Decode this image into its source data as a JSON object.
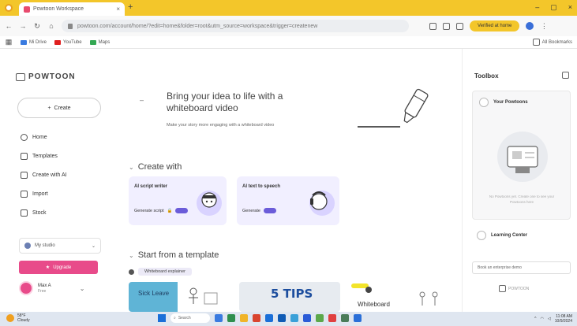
{
  "browser": {
    "tab_title": "Powtoon Workspace",
    "tab_close": "×",
    "new_tab": "+",
    "window_controls": [
      "–",
      "▢",
      "×"
    ],
    "url": "powtoon.com/account/home/?edit=home&folder=root&utm_source=workspace&trigger=createnew",
    "verify_label": "Verified at home",
    "bookmarks": [
      {
        "label": "Mi Drive",
        "color": "#3a7be0"
      },
      {
        "label": "YouTube",
        "color": "#e02020"
      },
      {
        "label": "Maps",
        "color": "#34a853"
      }
    ],
    "bookmarks_right": "All Bookmarks"
  },
  "sidebar": {
    "logo": "POWTOON",
    "create_label": "Create",
    "nav": [
      {
        "label": "Home",
        "icon": "home-icon"
      },
      {
        "label": "Templates",
        "icon": "templates-icon"
      },
      {
        "label": "Create with AI",
        "icon": "ai-icon"
      },
      {
        "label": "Import",
        "icon": "import-icon"
      },
      {
        "label": "Stock",
        "icon": "stock-icon"
      }
    ],
    "workspace_label": "My studio",
    "upgrade_label": "Upgrade",
    "user_name": "Max A",
    "user_plan": "Free"
  },
  "main": {
    "hero_title": "Bring your idea to life with a whiteboard video",
    "hero_sub": "Make your story more engaging with a whiteboard video",
    "create_with": "Create with",
    "cards": [
      {
        "title": "AI script writer",
        "action": "Generate script"
      },
      {
        "title": "AI text to speech",
        "action": "Generate"
      }
    ],
    "start_template": "Start from a template",
    "template_chip": "Whiteboard explainer",
    "thumbs": [
      {
        "text": "Sick Leave"
      },
      {
        "text": "5 TIPS"
      },
      {
        "text": "Whiteboard"
      }
    ]
  },
  "toolbox": {
    "title": "Toolbox",
    "row1": "Your Powtoons",
    "note": "No Powtoons yet. Create one to see your Powtoons here",
    "learning": "Learning Center",
    "search": "Book an enterprise demo",
    "brand": "POWTOON"
  },
  "taskbar": {
    "weather_temp": "58°F",
    "weather_desc": "Cloudy",
    "search": "Search",
    "time": "11:08 AM",
    "date": "10/9/2024"
  },
  "colors": {
    "chrome": "#f3c62a",
    "accent": "#e84b8a",
    "card": "#f1efff",
    "pill": "#6b5cd9"
  }
}
